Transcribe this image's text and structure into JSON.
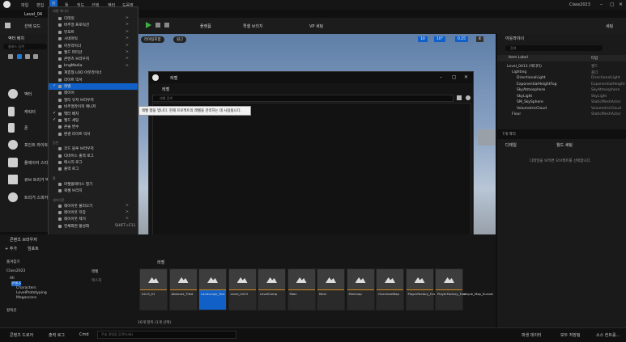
{
  "app": {
    "level_tab": "Level_04",
    "window_title": "Class2023",
    "menubar": [
      "파일",
      "편집",
      "창",
      "툴",
      "빌드",
      "선택",
      "액터",
      "도움말"
    ],
    "settings_label": "세팅"
  },
  "toolbar": {
    "mode_label": "선택 모드",
    "platform_label": "플랫폼",
    "quick_add_label": "퀵셀 브리지",
    "vp_label": "VP 세팅"
  },
  "viewport": {
    "perspective_label": "원근",
    "lit_label": "라이팅포함",
    "grid_value": "10",
    "rot_value": "10°",
    "scale_value": "0.25",
    "cam_value": "4"
  },
  "menu": {
    "section_levels": "레벨 에디터",
    "items": [
      {
        "label": "디테일",
        "arrow": ">"
      },
      {
        "label": "버추얼 프로덕션",
        "arrow": ">"
      },
      {
        "label": "뷰포트",
        "arrow": ">"
      },
      {
        "label": "시네마틱",
        "arrow": ">"
      },
      {
        "label": "아웃라이너",
        "arrow": ">"
      },
      {
        "label": "월드 파티션",
        "arrow": ">"
      },
      {
        "label": "콘텐츠 브라우저",
        "arrow": ">"
      },
      {
        "label": "ImgMedia",
        "arrow": ">"
      },
      {
        "label": "계층형 LOD 아웃라이너",
        "arrow": ""
      },
      {
        "label": "라이트 믹서",
        "arrow": ""
      },
      {
        "label": "레벨",
        "arrow": "",
        "checked": true,
        "highlight": true
      },
      {
        "label": "레이어",
        "arrow": ""
      },
      {
        "label": "멀티 유저 브라우저",
        "arrow": ""
      },
      {
        "label": "비주얼라이저 매니저",
        "arrow": ""
      },
      {
        "label": "액터 배치",
        "arrow": "",
        "checked": true
      },
      {
        "label": "월드 세팅",
        "arrow": "",
        "checked": true
      },
      {
        "label": "콘솔 변수",
        "arrow": ""
      },
      {
        "label": "환경 라이트 믹서",
        "arrow": ""
      }
    ],
    "section_general": "일반",
    "general_items": [
      {
        "label": "코드 블루 브라우저"
      },
      {
        "label": "디바이스 출력 로그"
      },
      {
        "label": "메시지 로그"
      },
      {
        "label": "출력 로그"
      }
    ],
    "section_tools": "툴",
    "tools_items": [
      {
        "label": "마켓플레이스 열기"
      },
      {
        "label": "퀵셀 브리지"
      }
    ],
    "section_layout": "레이아웃",
    "layout_items": [
      {
        "label": "레이아웃 불러오기",
        "arrow": ">"
      },
      {
        "label": "레이아웃 저장",
        "arrow": ">"
      },
      {
        "label": "레이아웃 제거",
        "arrow": ">"
      },
      {
        "label": "전체화면 활성화",
        "shortcut": "SHIFT+F11"
      }
    ]
  },
  "tooltip": "레벨 탭을 엽니다. 현재 프로젝트의 레벨을 관리하는 데 사용됩니다.",
  "levels_window": {
    "tab": "레벨",
    "menu": "레벨",
    "search_placeholder": "레벨 검색"
  },
  "place_actors": {
    "title": "액터 배치",
    "search_placeholder": "클래스 검색",
    "items": [
      "액터",
      "캐릭터",
      "폰",
      "포인트 라이트",
      "플레이어 스타트",
      "큐브 트리거 박스",
      "트리거 스피어"
    ]
  },
  "outliner": {
    "title": "아웃라이너",
    "search_placeholder": "검색",
    "col_label": "Item Label",
    "col_type": "타입",
    "rows": [
      {
        "label": "Level_0413 (에디터)",
        "type": "월드",
        "indent": 1
      },
      {
        "label": "Lighting",
        "type": "폴더",
        "indent": 2
      },
      {
        "label": "DirectionalLight",
        "type": "DirectionalLight",
        "indent": 3
      },
      {
        "label": "ExponentialHeightFog",
        "type": "ExponentialHeight",
        "indent": 3
      },
      {
        "label": "SkyAtmosphere",
        "type": "SkyAtmosphere",
        "indent": 3
      },
      {
        "label": "SkyLight",
        "type": "SkyLight",
        "indent": 3
      },
      {
        "label": "SM_SkySphere",
        "type": "StaticMeshActor",
        "indent": 3
      },
      {
        "label": "VolumetricCloud",
        "type": "VolumetricCloud",
        "indent": 3
      },
      {
        "label": "Floor",
        "type": "StaticMeshActor",
        "indent": 2
      }
    ],
    "count": "7개 액터"
  },
  "details": {
    "tab_details": "디테일",
    "tab_world": "월드 세팅",
    "empty_msg": "디테일을 보려면 오브젝트를 선택합니다."
  },
  "content_browser": {
    "title": "콘텐츠 브라우저",
    "add_label": "+ 추가",
    "import_label": "임포트",
    "favorites": "즐겨찾기",
    "project": "Class2023",
    "folders": [
      "All",
      "콘텐츠",
      "Characters",
      "LevelPrototyping",
      "Megascans"
    ],
    "collections": "컬렉션",
    "filter_path": "레벨",
    "filter_sub": "텍스처",
    "count": "16개 항목 (1개 선택)",
    "assets": [
      "0413_01",
      "Abstract_Tiled",
      "Landscape_Test",
      "Level_0413",
      "LevelComp",
      "Main",
      "Main",
      "Minimap",
      "OverviewMap",
      "PlayerFactory_Example_Map_Daytime",
      "PlayerFactory_Example_Map_Sunset"
    ]
  },
  "status": {
    "drawer": "콘텐츠 드로어",
    "output": "출력 로그",
    "cmd": "Cmd",
    "cmd_placeholder": "콘솔 명령을 입력하세요",
    "trace": "파생 데이터",
    "save": "모두 저장됨",
    "source": "소스 컨트롤..."
  }
}
